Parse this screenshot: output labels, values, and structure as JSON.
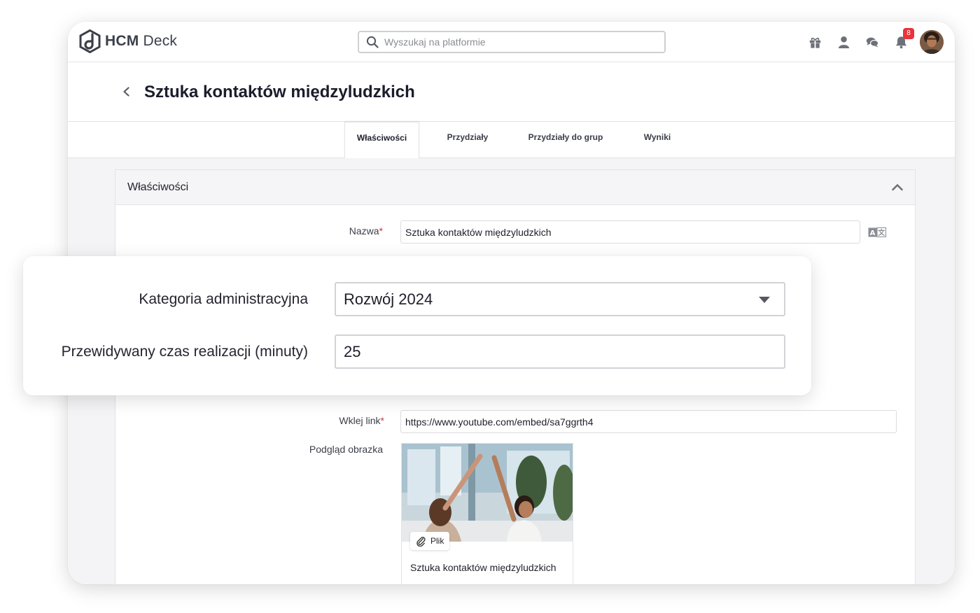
{
  "app": {
    "logo_bold": "HCM",
    "logo_regular": " Deck"
  },
  "search": {
    "placeholder": "Wyszukaj na platformie"
  },
  "header": {
    "notifications_count": "8",
    "icons": [
      "gift-icon",
      "user-icon",
      "chat-icon",
      "bell-icon"
    ]
  },
  "page": {
    "title": "Sztuka kontaktów międzyludzkich"
  },
  "tabs": [
    {
      "label": "Właściwości",
      "active": true
    },
    {
      "label": "Przydziały",
      "active": false
    },
    {
      "label": "Przydziały do grup",
      "active": false
    },
    {
      "label": "Wyniki",
      "active": false
    }
  ],
  "properties": {
    "section_title": "Właściwości",
    "name_label": "Nazwa",
    "name_value": "Sztuka kontaktów międzyludzkich",
    "link_label": "Wklej link",
    "link_value": "https://www.youtube.com/embed/sa7ggrth4",
    "preview_label": "Podgląd obrazka",
    "file_chip_label": "Plik",
    "preview_caption": "Sztuka kontaktów międzyludzkich",
    "required_mark": "*"
  },
  "overlay": {
    "category_label": "Kategoria administracyjna",
    "category_value": "Rozwój 2024",
    "duration_label": "Przewidywany czas realizacji (minuty)",
    "duration_value": "25"
  },
  "colors": {
    "accent_required": "#d3313a",
    "badge": "#e8343b",
    "icon_gray": "#6d7079"
  }
}
